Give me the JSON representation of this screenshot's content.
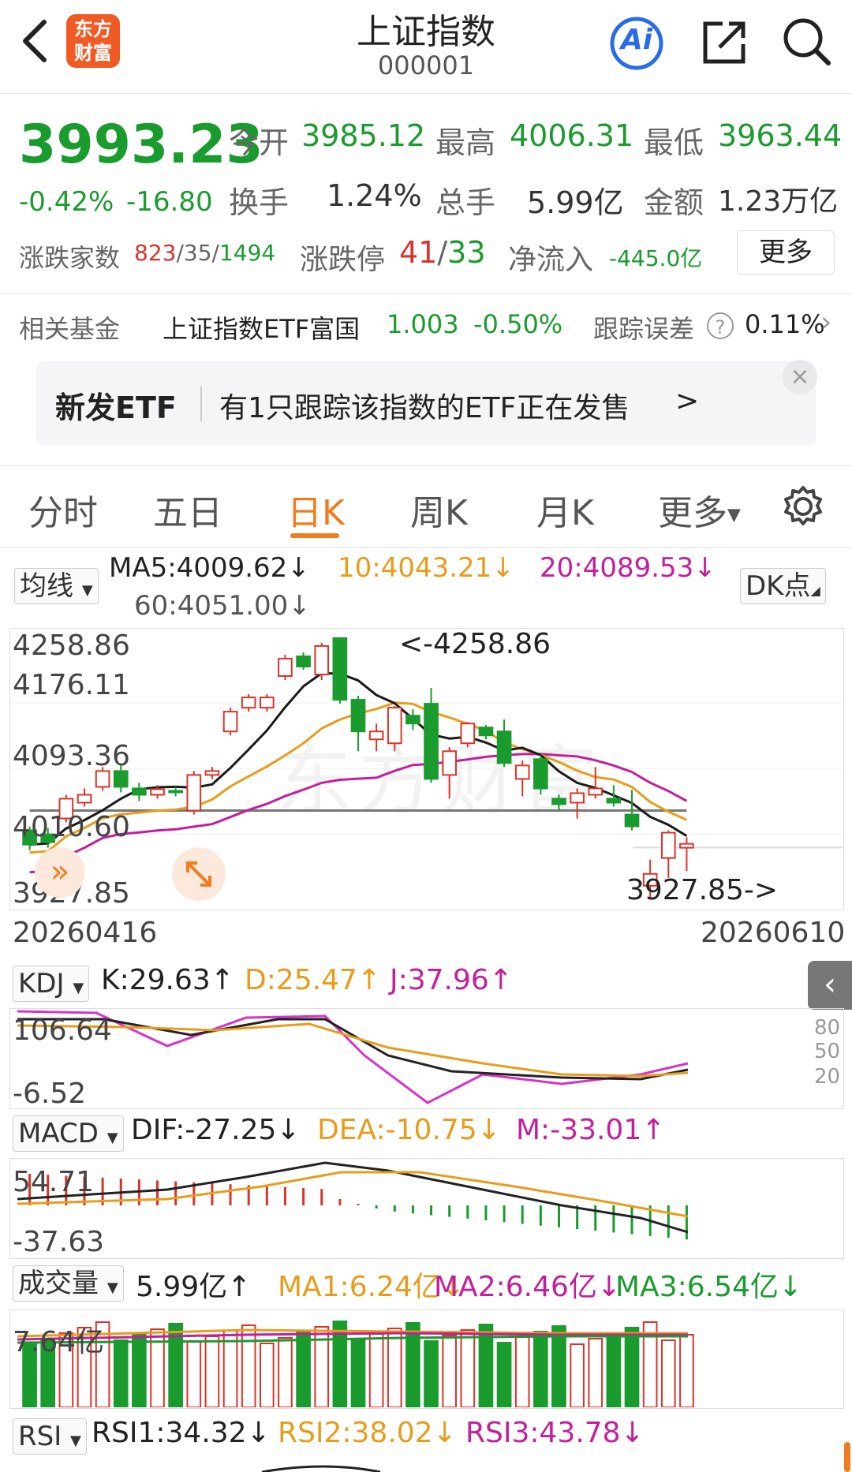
{
  "header": {
    "title": "上证指数",
    "code": "000001",
    "logo_line1": "东方",
    "logo_line2": "财富",
    "ai_label": "Ai",
    "icons": [
      "back-icon",
      "ai-icon",
      "share-icon",
      "search-icon"
    ]
  },
  "quote": {
    "price": "3993.23",
    "change_pct": "-0.42%",
    "change": "-16.80",
    "open_label": "今开",
    "open": "3985.12",
    "high_label": "最高",
    "high": "4006.31",
    "low_label": "最低",
    "low": "3963.44",
    "turnover_label": "换手",
    "turnover": "1.24%",
    "volume_label": "总手",
    "volume": "5.99亿",
    "amount_label": "金额",
    "amount": "1.23万亿",
    "breadth_label": "涨跌家数",
    "breadth_up": "823",
    "breadth_flat": "35",
    "breadth_down": "1494",
    "slash": "/",
    "limit_label": "涨跌停",
    "limit_up": "41",
    "limit_down": "33",
    "inflow_label": "净流入",
    "inflow": "-445.0亿",
    "more_button": "更多"
  },
  "fund": {
    "label": "相关基金",
    "name": "上证指数ETF富国",
    "price": "1.003",
    "change": "-0.50%",
    "track_label": "跟踪误差",
    "track_value": "0.11%",
    "chevron": "›"
  },
  "banner": {
    "tag": "新发ETF",
    "text": "有1只跟踪该指数的ETF正在发售",
    "arrow": ">",
    "close": "×"
  },
  "tabs": [
    {
      "label": "分时",
      "active": false
    },
    {
      "label": "五日",
      "active": false
    },
    {
      "label": "日K",
      "active": true
    },
    {
      "label": "周K",
      "active": false
    },
    {
      "label": "月K",
      "active": false
    },
    {
      "label": "更多",
      "active": false
    }
  ],
  "kline": {
    "selector": "均线",
    "ma5": "MA5:4009.62↓",
    "ma10": "10:4043.21↓",
    "ma20": "20:4089.53↓",
    "ma60": "60:4051.00↓",
    "dk_button": "DK点",
    "y_labels": [
      "4258.86",
      "4176.11",
      "4093.36",
      "4010.60",
      "3927.85"
    ],
    "max_note": "<-4258.86",
    "min_note": "3927.85->",
    "date_start": "20260416",
    "date_end": "20260610",
    "watermark": "东方财富"
  },
  "kdj": {
    "selector": "KDJ",
    "k": "K:29.63↑",
    "d": "D:25.47↑",
    "j": "J:37.96↑",
    "y_top": "106.64",
    "y_bottom": "-6.52",
    "right_levels": [
      "80",
      "50",
      "20"
    ]
  },
  "macd": {
    "selector": "MACD",
    "dif": "DIF:-27.25↓",
    "dea": "DEA:-10.75↓",
    "m": "M:-33.01↑",
    "y_top": "54.71",
    "y_bottom": "-37.63"
  },
  "vol": {
    "selector": "成交量",
    "value": "5.99亿↑",
    "ma1": "MA1:6.24亿↓",
    "ma2": "MA2:6.46亿↓",
    "ma3": "MA3:6.54亿↓",
    "y_top": "7.64亿"
  },
  "rsi": {
    "selector": "RSI",
    "rsi1": "RSI1:34.32↓",
    "rsi2": "RSI2:38.02↓",
    "rsi3": "RSI3:43.78↓"
  },
  "colors": {
    "up": "#d9342b",
    "down": "#1a9b2e",
    "accent": "#f07c1e",
    "ma5": "#1a1a1a",
    "ma10": "#e89c1b",
    "ma20": "#c41e9c",
    "ma60": "#777777"
  },
  "chart_data": {
    "type": "candlestick",
    "y_range": [
      3927.85,
      4258.86
    ],
    "candles": [
      {
        "o": 4015,
        "c": 3997,
        "h": 4020,
        "l": 3990
      },
      {
        "o": 4010,
        "c": 4000,
        "h": 4018,
        "l": 3993
      },
      {
        "o": 4030,
        "c": 4055,
        "h": 4060,
        "l": 4025
      },
      {
        "o": 4050,
        "c": 4060,
        "h": 4068,
        "l": 4045
      },
      {
        "o": 4070,
        "c": 4090,
        "h": 4095,
        "l": 4065
      },
      {
        "o": 4090,
        "c": 4070,
        "h": 4097,
        "l": 4063
      },
      {
        "o": 4068,
        "c": 4060,
        "h": 4075,
        "l": 4052
      },
      {
        "o": 4060,
        "c": 4067,
        "h": 4072,
        "l": 4055
      },
      {
        "o": 4065,
        "c": 4063,
        "h": 4070,
        "l": 4058
      },
      {
        "o": 4040,
        "c": 4085,
        "h": 4090,
        "l": 4035
      },
      {
        "o": 4085,
        "c": 4090,
        "h": 4095,
        "l": 4080
      },
      {
        "o": 4140,
        "c": 4165,
        "h": 4170,
        "l": 4135
      },
      {
        "o": 4170,
        "c": 4183,
        "h": 4187,
        "l": 4165
      },
      {
        "o": 4170,
        "c": 4183,
        "h": 4187,
        "l": 4165
      },
      {
        "o": 4210,
        "c": 4232,
        "h": 4237,
        "l": 4205
      },
      {
        "o": 4235,
        "c": 4222,
        "h": 4240,
        "l": 4218
      },
      {
        "o": 4212,
        "c": 4248,
        "h": 4252,
        "l": 4205
      },
      {
        "o": 4258,
        "c": 4180,
        "h": 4258.86,
        "l": 4175
      },
      {
        "o": 4180,
        "c": 4140,
        "h": 4185,
        "l": 4115
      },
      {
        "o": 4130,
        "c": 4140,
        "h": 4150,
        "l": 4115
      },
      {
        "o": 4125,
        "c": 4170,
        "h": 4172,
        "l": 4115
      },
      {
        "o": 4160,
        "c": 4150,
        "h": 4168,
        "l": 4142
      },
      {
        "o": 4175,
        "c": 4080,
        "h": 4195,
        "l": 4075
      },
      {
        "o": 4085,
        "c": 4115,
        "h": 4120,
        "l": 4055
      },
      {
        "o": 4125,
        "c": 4150,
        "h": 4152,
        "l": 4120
      },
      {
        "o": 4145,
        "c": 4135,
        "h": 4148,
        "l": 4130
      },
      {
        "o": 4140,
        "c": 4100,
        "h": 4155,
        "l": 4095
      },
      {
        "o": 4080,
        "c": 4097,
        "h": 4103,
        "l": 4058
      },
      {
        "o": 4105,
        "c": 4068,
        "h": 4110,
        "l": 4060
      },
      {
        "o": 4055,
        "c": 4048,
        "h": 4060,
        "l": 4040
      },
      {
        "o": 4050,
        "c": 4062,
        "h": 4068,
        "l": 4030
      },
      {
        "o": 4060,
        "c": 4068,
        "h": 4095,
        "l": 4055
      },
      {
        "o": 4055,
        "c": 4050,
        "h": 4072,
        "l": 4045
      },
      {
        "o": 4035,
        "c": 4020,
        "h": 4066,
        "l": 4015
      },
      {
        "o": 3945,
        "c": 3960,
        "h": 3978,
        "l": 3927.85
      },
      {
        "o": 3980,
        "c": 4012,
        "h": 4015,
        "l": 3955
      },
      {
        "o": 3993,
        "c": 3998,
        "h": 4006.31,
        "l": 3963.44
      }
    ]
  }
}
